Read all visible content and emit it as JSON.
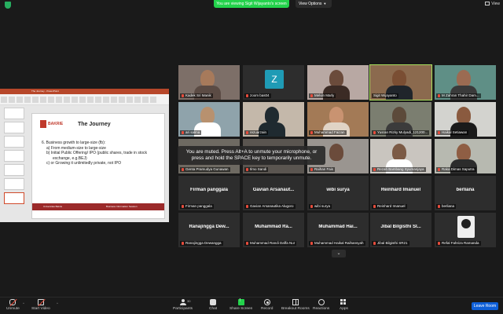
{
  "topbar": {
    "viewing_text": "You are viewing Sigit Wijayanto's screen",
    "view_options_label": "View Options",
    "view_label": "View"
  },
  "shared_screen": {
    "window_title": "The Journey - PowerPoint",
    "logo_text": "BAKRIE",
    "slide_heading": "The Journey",
    "lines": [
      "6. Business growth to large-size (fb):",
      "a)   From medium-size to large-size",
      "b)   Initial Public Offering/ IPO (public shares, trade in stock",
      "exchange, e.g.BEJ)",
      "c)   or Growing it unlimitedly private, not IPO"
    ],
    "footer_left": "Universitas Bakrie",
    "footer_right": "Business Information Session"
  },
  "participants": [
    {
      "name": "Kadek Sri Manik",
      "type": "video"
    },
    {
      "name": "zoom bas04",
      "type": "avatar",
      "initial": "Z"
    },
    {
      "name": "Melvin Marly",
      "type": "video"
    },
    {
      "name": "Sigit Wijayanto",
      "type": "video",
      "active": true
    },
    {
      "name": "M Zahran Thahir Dam...",
      "type": "video"
    },
    {
      "name": "ari salma",
      "type": "video"
    },
    {
      "name": "rezuarzain",
      "type": "video"
    },
    {
      "name": "Muhammad Faizan",
      "type": "video"
    },
    {
      "name": "Yusran Rizky Mulyadi_121200...",
      "type": "video"
    },
    {
      "name": "Haikal Setiawan",
      "type": "video"
    },
    {
      "name": "Genta Pramudya Gunawan",
      "type": "video"
    },
    {
      "name": "Ilmo Sandi",
      "type": "video"
    },
    {
      "name": "Raihan Fais",
      "type": "video"
    },
    {
      "name": "Rezah Bambang Syumanjaya",
      "type": "video"
    },
    {
      "name": "Raka Dimas Saputra",
      "type": "video"
    },
    {
      "name": "Firman panggala",
      "type": "name",
      "label": "Firman panggala"
    },
    {
      "name": "Gavian Arsanautika Alugoro",
      "type": "name",
      "label": "Gavian  Arsanaut..."
    },
    {
      "name": "wibi surya",
      "type": "name",
      "label": "wibi surya"
    },
    {
      "name": "Reinhard Imanuel",
      "type": "name",
      "label": "Reinhard Imanuel"
    },
    {
      "name": "berliana",
      "type": "name",
      "label": "berliana"
    },
    {
      "name": "Ranajingga Dewangga",
      "type": "name",
      "label": "Ranajingga  Dew..."
    },
    {
      "name": "Muhammad Randi Daffa Nur",
      "type": "name",
      "label": "Muhammad  Ra..."
    },
    {
      "name": "Muhammad Haikal Raihansyah",
      "type": "name",
      "label": "Muhammad  Hai..."
    },
    {
      "name": "Jibal Bilgisthi SR21",
      "type": "name",
      "label": "Jibal  Bilgisthi  SI..."
    },
    {
      "name": "Refal Fahriza Ramanda",
      "type": "photo"
    }
  ],
  "toast": "You are muted. Press Alt+A to unmute your microphone, or press and hold the SPACE key to temporarily unmute.",
  "toolbar": {
    "unmute": "Unmute",
    "start_video": "Start Video",
    "participants": "Participants",
    "participants_count": "30",
    "chat": "Chat",
    "share_screen": "Share Screen",
    "record": "Record",
    "breakout": "Breakout Rooms",
    "reactions": "Reactions",
    "apps": "Apps",
    "leave": "Leave Room"
  },
  "colors": {
    "share_green": "#23d24b",
    "leave_blue": "#0e5fd8",
    "zoom_avatar": "#1f9bb5",
    "slide_red": "#9b2a2a"
  }
}
